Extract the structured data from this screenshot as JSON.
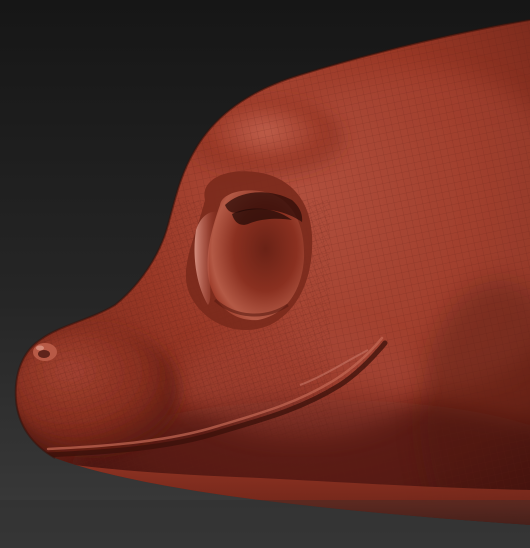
{
  "scene": {
    "subject": "sculpted-creature-head",
    "colors": {
      "background_top": "#1c1c1c",
      "background_bottom": "#3a3a3a",
      "clay_base": "#7a2a1c",
      "clay_mid": "#9a3826",
      "clay_highlight": "#d07a66",
      "clay_shadow": "#4a1610",
      "clay_deep_shadow": "#2e0c08",
      "wireframe": "#5e1e14"
    }
  }
}
